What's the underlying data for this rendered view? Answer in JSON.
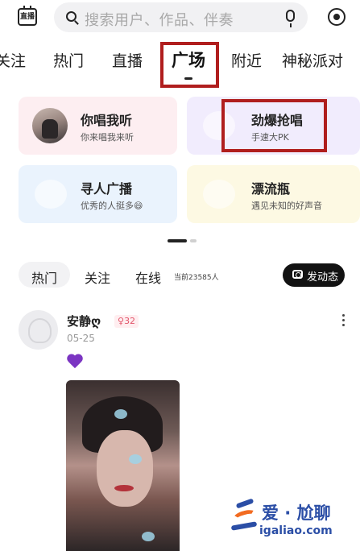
{
  "header": {
    "live_icon_label": "直播",
    "search_placeholder": "搜索用户、作品、伴奏",
    "icons": [
      "calendar-live-icon",
      "search-icon",
      "microphone-icon",
      "radar-icon"
    ]
  },
  "tabs": [
    {
      "label": "关注",
      "visible_text": "关注"
    },
    {
      "label": "热门"
    },
    {
      "label": "直播"
    },
    {
      "label": "广场",
      "active": true
    },
    {
      "label": "附近"
    },
    {
      "label": "神秘派对"
    }
  ],
  "cards": [
    {
      "title": "你唱我听",
      "subtitle": "你来唱我来听"
    },
    {
      "title": "劲爆抢唱",
      "subtitle": "手速大PK"
    },
    {
      "title": "寻人广播",
      "subtitle": "优秀的人挺多😄"
    },
    {
      "title": "漂流瓶",
      "subtitle": "遇见未知的好声音"
    }
  ],
  "feed": {
    "tabs": [
      "热门",
      "关注",
      "在线"
    ],
    "online_count": "当前23585人",
    "post_button": "发动态"
  },
  "post": {
    "username": "安静ღ",
    "level": "32",
    "date": "05-25",
    "emoji": "💜"
  },
  "watermark": {
    "title": "爱 · 尬聊",
    "url": "igaliao.com"
  },
  "colors": {
    "highlight_box": "#b01e1e",
    "watermark_blue": "#2b4ea6",
    "watermark_orange": "#f26b21",
    "badge_pink": "#e2566b"
  }
}
